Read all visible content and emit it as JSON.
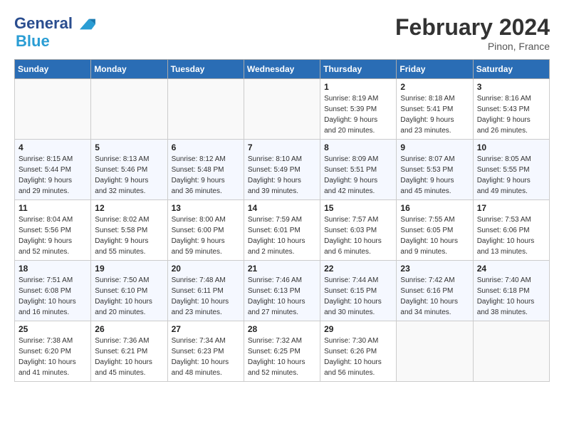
{
  "header": {
    "logo_line1": "General",
    "logo_line2": "Blue",
    "month_year": "February 2024",
    "location": "Pinon, France"
  },
  "weekdays": [
    "Sunday",
    "Monday",
    "Tuesday",
    "Wednesday",
    "Thursday",
    "Friday",
    "Saturday"
  ],
  "weeks": [
    [
      {
        "day": "",
        "info": ""
      },
      {
        "day": "",
        "info": ""
      },
      {
        "day": "",
        "info": ""
      },
      {
        "day": "",
        "info": ""
      },
      {
        "day": "1",
        "info": "Sunrise: 8:19 AM\nSunset: 5:39 PM\nDaylight: 9 hours\nand 20 minutes."
      },
      {
        "day": "2",
        "info": "Sunrise: 8:18 AM\nSunset: 5:41 PM\nDaylight: 9 hours\nand 23 minutes."
      },
      {
        "day": "3",
        "info": "Sunrise: 8:16 AM\nSunset: 5:43 PM\nDaylight: 9 hours\nand 26 minutes."
      }
    ],
    [
      {
        "day": "4",
        "info": "Sunrise: 8:15 AM\nSunset: 5:44 PM\nDaylight: 9 hours\nand 29 minutes."
      },
      {
        "day": "5",
        "info": "Sunrise: 8:13 AM\nSunset: 5:46 PM\nDaylight: 9 hours\nand 32 minutes."
      },
      {
        "day": "6",
        "info": "Sunrise: 8:12 AM\nSunset: 5:48 PM\nDaylight: 9 hours\nand 36 minutes."
      },
      {
        "day": "7",
        "info": "Sunrise: 8:10 AM\nSunset: 5:49 PM\nDaylight: 9 hours\nand 39 minutes."
      },
      {
        "day": "8",
        "info": "Sunrise: 8:09 AM\nSunset: 5:51 PM\nDaylight: 9 hours\nand 42 minutes."
      },
      {
        "day": "9",
        "info": "Sunrise: 8:07 AM\nSunset: 5:53 PM\nDaylight: 9 hours\nand 45 minutes."
      },
      {
        "day": "10",
        "info": "Sunrise: 8:05 AM\nSunset: 5:55 PM\nDaylight: 9 hours\nand 49 minutes."
      }
    ],
    [
      {
        "day": "11",
        "info": "Sunrise: 8:04 AM\nSunset: 5:56 PM\nDaylight: 9 hours\nand 52 minutes."
      },
      {
        "day": "12",
        "info": "Sunrise: 8:02 AM\nSunset: 5:58 PM\nDaylight: 9 hours\nand 55 minutes."
      },
      {
        "day": "13",
        "info": "Sunrise: 8:00 AM\nSunset: 6:00 PM\nDaylight: 9 hours\nand 59 minutes."
      },
      {
        "day": "14",
        "info": "Sunrise: 7:59 AM\nSunset: 6:01 PM\nDaylight: 10 hours\nand 2 minutes."
      },
      {
        "day": "15",
        "info": "Sunrise: 7:57 AM\nSunset: 6:03 PM\nDaylight: 10 hours\nand 6 minutes."
      },
      {
        "day": "16",
        "info": "Sunrise: 7:55 AM\nSunset: 6:05 PM\nDaylight: 10 hours\nand 9 minutes."
      },
      {
        "day": "17",
        "info": "Sunrise: 7:53 AM\nSunset: 6:06 PM\nDaylight: 10 hours\nand 13 minutes."
      }
    ],
    [
      {
        "day": "18",
        "info": "Sunrise: 7:51 AM\nSunset: 6:08 PM\nDaylight: 10 hours\nand 16 minutes."
      },
      {
        "day": "19",
        "info": "Sunrise: 7:50 AM\nSunset: 6:10 PM\nDaylight: 10 hours\nand 20 minutes."
      },
      {
        "day": "20",
        "info": "Sunrise: 7:48 AM\nSunset: 6:11 PM\nDaylight: 10 hours\nand 23 minutes."
      },
      {
        "day": "21",
        "info": "Sunrise: 7:46 AM\nSunset: 6:13 PM\nDaylight: 10 hours\nand 27 minutes."
      },
      {
        "day": "22",
        "info": "Sunrise: 7:44 AM\nSunset: 6:15 PM\nDaylight: 10 hours\nand 30 minutes."
      },
      {
        "day": "23",
        "info": "Sunrise: 7:42 AM\nSunset: 6:16 PM\nDaylight: 10 hours\nand 34 minutes."
      },
      {
        "day": "24",
        "info": "Sunrise: 7:40 AM\nSunset: 6:18 PM\nDaylight: 10 hours\nand 38 minutes."
      }
    ],
    [
      {
        "day": "25",
        "info": "Sunrise: 7:38 AM\nSunset: 6:20 PM\nDaylight: 10 hours\nand 41 minutes."
      },
      {
        "day": "26",
        "info": "Sunrise: 7:36 AM\nSunset: 6:21 PM\nDaylight: 10 hours\nand 45 minutes."
      },
      {
        "day": "27",
        "info": "Sunrise: 7:34 AM\nSunset: 6:23 PM\nDaylight: 10 hours\nand 48 minutes."
      },
      {
        "day": "28",
        "info": "Sunrise: 7:32 AM\nSunset: 6:25 PM\nDaylight: 10 hours\nand 52 minutes."
      },
      {
        "day": "29",
        "info": "Sunrise: 7:30 AM\nSunset: 6:26 PM\nDaylight: 10 hours\nand 56 minutes."
      },
      {
        "day": "",
        "info": ""
      },
      {
        "day": "",
        "info": ""
      }
    ]
  ]
}
